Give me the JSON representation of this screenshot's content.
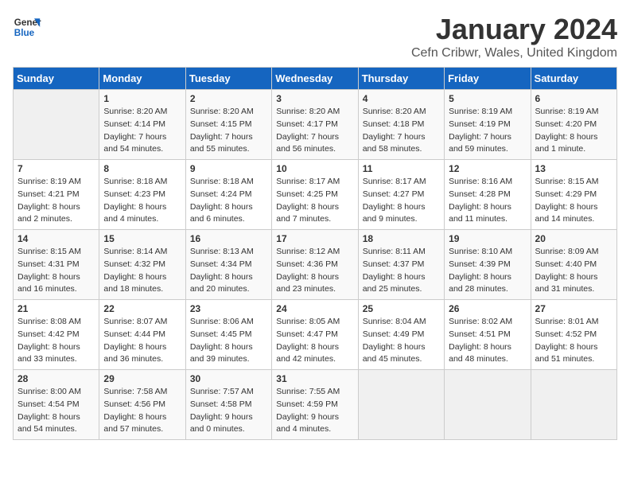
{
  "logo": {
    "line1": "General",
    "line2": "Blue"
  },
  "title": "January 2024",
  "subtitle": "Cefn Cribwr, Wales, United Kingdom",
  "days_of_week": [
    "Sunday",
    "Monday",
    "Tuesday",
    "Wednesday",
    "Thursday",
    "Friday",
    "Saturday"
  ],
  "weeks": [
    [
      {
        "day": "",
        "sunrise": "",
        "sunset": "",
        "daylight": ""
      },
      {
        "day": "1",
        "sunrise": "Sunrise: 8:20 AM",
        "sunset": "Sunset: 4:14 PM",
        "daylight": "Daylight: 7 hours and 54 minutes."
      },
      {
        "day": "2",
        "sunrise": "Sunrise: 8:20 AM",
        "sunset": "Sunset: 4:15 PM",
        "daylight": "Daylight: 7 hours and 55 minutes."
      },
      {
        "day": "3",
        "sunrise": "Sunrise: 8:20 AM",
        "sunset": "Sunset: 4:17 PM",
        "daylight": "Daylight: 7 hours and 56 minutes."
      },
      {
        "day": "4",
        "sunrise": "Sunrise: 8:20 AM",
        "sunset": "Sunset: 4:18 PM",
        "daylight": "Daylight: 7 hours and 58 minutes."
      },
      {
        "day": "5",
        "sunrise": "Sunrise: 8:19 AM",
        "sunset": "Sunset: 4:19 PM",
        "daylight": "Daylight: 7 hours and 59 minutes."
      },
      {
        "day": "6",
        "sunrise": "Sunrise: 8:19 AM",
        "sunset": "Sunset: 4:20 PM",
        "daylight": "Daylight: 8 hours and 1 minute."
      }
    ],
    [
      {
        "day": "7",
        "sunrise": "Sunrise: 8:19 AM",
        "sunset": "Sunset: 4:21 PM",
        "daylight": "Daylight: 8 hours and 2 minutes."
      },
      {
        "day": "8",
        "sunrise": "Sunrise: 8:18 AM",
        "sunset": "Sunset: 4:23 PM",
        "daylight": "Daylight: 8 hours and 4 minutes."
      },
      {
        "day": "9",
        "sunrise": "Sunrise: 8:18 AM",
        "sunset": "Sunset: 4:24 PM",
        "daylight": "Daylight: 8 hours and 6 minutes."
      },
      {
        "day": "10",
        "sunrise": "Sunrise: 8:17 AM",
        "sunset": "Sunset: 4:25 PM",
        "daylight": "Daylight: 8 hours and 7 minutes."
      },
      {
        "day": "11",
        "sunrise": "Sunrise: 8:17 AM",
        "sunset": "Sunset: 4:27 PM",
        "daylight": "Daylight: 8 hours and 9 minutes."
      },
      {
        "day": "12",
        "sunrise": "Sunrise: 8:16 AM",
        "sunset": "Sunset: 4:28 PM",
        "daylight": "Daylight: 8 hours and 11 minutes."
      },
      {
        "day": "13",
        "sunrise": "Sunrise: 8:15 AM",
        "sunset": "Sunset: 4:29 PM",
        "daylight": "Daylight: 8 hours and 14 minutes."
      }
    ],
    [
      {
        "day": "14",
        "sunrise": "Sunrise: 8:15 AM",
        "sunset": "Sunset: 4:31 PM",
        "daylight": "Daylight: 8 hours and 16 minutes."
      },
      {
        "day": "15",
        "sunrise": "Sunrise: 8:14 AM",
        "sunset": "Sunset: 4:32 PM",
        "daylight": "Daylight: 8 hours and 18 minutes."
      },
      {
        "day": "16",
        "sunrise": "Sunrise: 8:13 AM",
        "sunset": "Sunset: 4:34 PM",
        "daylight": "Daylight: 8 hours and 20 minutes."
      },
      {
        "day": "17",
        "sunrise": "Sunrise: 8:12 AM",
        "sunset": "Sunset: 4:36 PM",
        "daylight": "Daylight: 8 hours and 23 minutes."
      },
      {
        "day": "18",
        "sunrise": "Sunrise: 8:11 AM",
        "sunset": "Sunset: 4:37 PM",
        "daylight": "Daylight: 8 hours and 25 minutes."
      },
      {
        "day": "19",
        "sunrise": "Sunrise: 8:10 AM",
        "sunset": "Sunset: 4:39 PM",
        "daylight": "Daylight: 8 hours and 28 minutes."
      },
      {
        "day": "20",
        "sunrise": "Sunrise: 8:09 AM",
        "sunset": "Sunset: 4:40 PM",
        "daylight": "Daylight: 8 hours and 31 minutes."
      }
    ],
    [
      {
        "day": "21",
        "sunrise": "Sunrise: 8:08 AM",
        "sunset": "Sunset: 4:42 PM",
        "daylight": "Daylight: 8 hours and 33 minutes."
      },
      {
        "day": "22",
        "sunrise": "Sunrise: 8:07 AM",
        "sunset": "Sunset: 4:44 PM",
        "daylight": "Daylight: 8 hours and 36 minutes."
      },
      {
        "day": "23",
        "sunrise": "Sunrise: 8:06 AM",
        "sunset": "Sunset: 4:45 PM",
        "daylight": "Daylight: 8 hours and 39 minutes."
      },
      {
        "day": "24",
        "sunrise": "Sunrise: 8:05 AM",
        "sunset": "Sunset: 4:47 PM",
        "daylight": "Daylight: 8 hours and 42 minutes."
      },
      {
        "day": "25",
        "sunrise": "Sunrise: 8:04 AM",
        "sunset": "Sunset: 4:49 PM",
        "daylight": "Daylight: 8 hours and 45 minutes."
      },
      {
        "day": "26",
        "sunrise": "Sunrise: 8:02 AM",
        "sunset": "Sunset: 4:51 PM",
        "daylight": "Daylight: 8 hours and 48 minutes."
      },
      {
        "day": "27",
        "sunrise": "Sunrise: 8:01 AM",
        "sunset": "Sunset: 4:52 PM",
        "daylight": "Daylight: 8 hours and 51 minutes."
      }
    ],
    [
      {
        "day": "28",
        "sunrise": "Sunrise: 8:00 AM",
        "sunset": "Sunset: 4:54 PM",
        "daylight": "Daylight: 8 hours and 54 minutes."
      },
      {
        "day": "29",
        "sunrise": "Sunrise: 7:58 AM",
        "sunset": "Sunset: 4:56 PM",
        "daylight": "Daylight: 8 hours and 57 minutes."
      },
      {
        "day": "30",
        "sunrise": "Sunrise: 7:57 AM",
        "sunset": "Sunset: 4:58 PM",
        "daylight": "Daylight: 9 hours and 0 minutes."
      },
      {
        "day": "31",
        "sunrise": "Sunrise: 7:55 AM",
        "sunset": "Sunset: 4:59 PM",
        "daylight": "Daylight: 9 hours and 4 minutes."
      },
      {
        "day": "",
        "sunrise": "",
        "sunset": "",
        "daylight": ""
      },
      {
        "day": "",
        "sunrise": "",
        "sunset": "",
        "daylight": ""
      },
      {
        "day": "",
        "sunrise": "",
        "sunset": "",
        "daylight": ""
      }
    ]
  ]
}
